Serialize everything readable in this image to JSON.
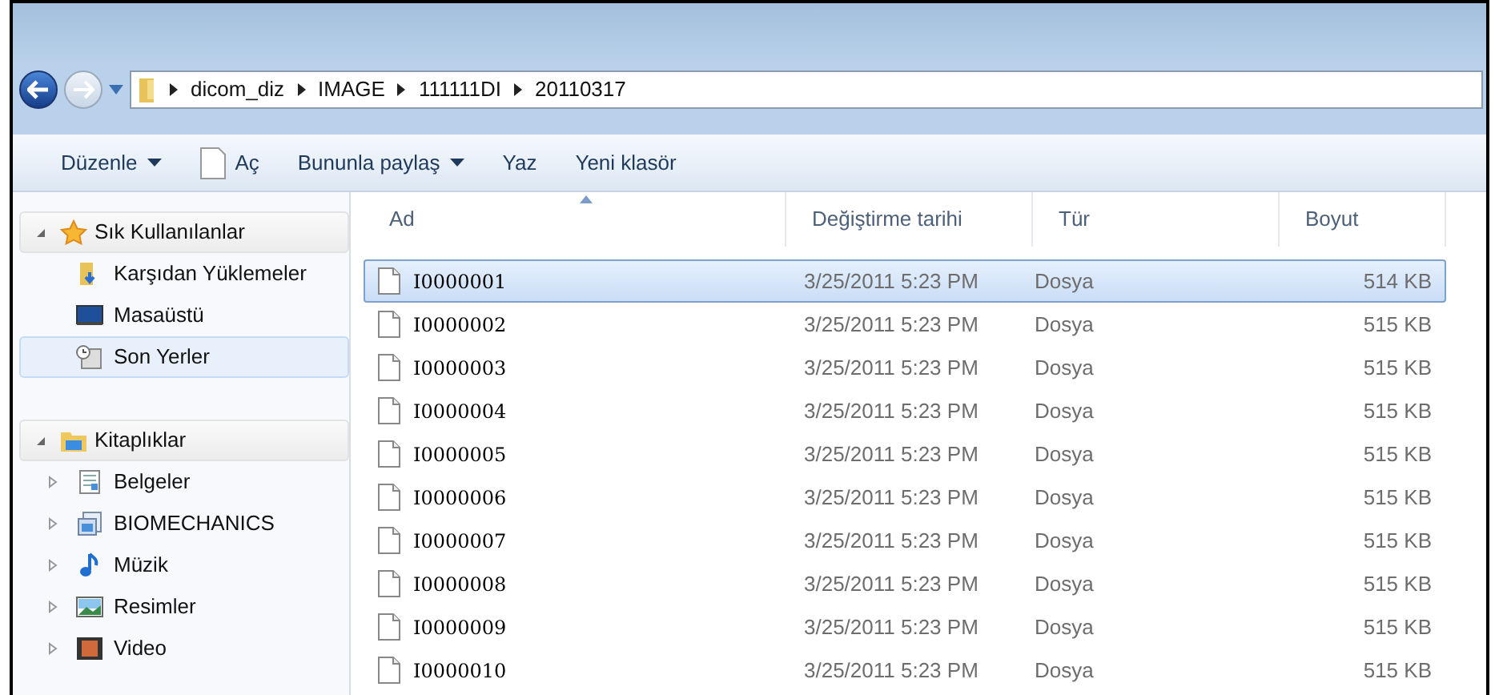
{
  "breadcrumb": [
    "dicom_diz",
    "IMAGE",
    "111111DI",
    "20110317"
  ],
  "toolbar": [
    {
      "label": "Düzenle",
      "dropdown": true,
      "icon": false
    },
    {
      "label": "Aç",
      "dropdown": false,
      "icon": true
    },
    {
      "label": "Bununla paylaş",
      "dropdown": true,
      "icon": false
    },
    {
      "label": "Yaz",
      "dropdown": false,
      "icon": false
    },
    {
      "label": "Yeni klasör",
      "dropdown": false,
      "icon": false
    }
  ],
  "sidebar": {
    "groups": [
      {
        "label": "Sık Kullanılanlar",
        "kind": "star",
        "expanded": true,
        "children": [
          {
            "label": "Karşıdan Yüklemeler",
            "kind": "downloads",
            "selected": false
          },
          {
            "label": "Masaüstü",
            "kind": "desktop",
            "selected": false
          },
          {
            "label": "Son Yerler",
            "kind": "recent",
            "selected": true
          }
        ]
      },
      {
        "label": "Kitaplıklar",
        "kind": "library",
        "expanded": true,
        "children": [
          {
            "label": "Belgeler",
            "kind": "documents",
            "selected": false,
            "expanded": false
          },
          {
            "label": "BIOMECHANICS",
            "kind": "stack",
            "selected": false,
            "expanded": false
          },
          {
            "label": "Müzik",
            "kind": "music",
            "selected": false,
            "expanded": false
          },
          {
            "label": "Resimler",
            "kind": "pictures",
            "selected": false,
            "expanded": false
          },
          {
            "label": "Video",
            "kind": "video",
            "selected": false,
            "expanded": false
          }
        ]
      }
    ]
  },
  "table": {
    "columns": [
      "Ad",
      "Değiştirme tarihi",
      "Tür",
      "Boyut"
    ],
    "rows": [
      {
        "name": "I0000001",
        "date": "3/25/2011 5:23 PM",
        "type": "Dosya",
        "size": "514 KB",
        "selected": true
      },
      {
        "name": "I0000002",
        "date": "3/25/2011 5:23 PM",
        "type": "Dosya",
        "size": "515 KB",
        "selected": false
      },
      {
        "name": "I0000003",
        "date": "3/25/2011 5:23 PM",
        "type": "Dosya",
        "size": "515 KB",
        "selected": false
      },
      {
        "name": "I0000004",
        "date": "3/25/2011 5:23 PM",
        "type": "Dosya",
        "size": "515 KB",
        "selected": false
      },
      {
        "name": "I0000005",
        "date": "3/25/2011 5:23 PM",
        "type": "Dosya",
        "size": "515 KB",
        "selected": false
      },
      {
        "name": "I0000006",
        "date": "3/25/2011 5:23 PM",
        "type": "Dosya",
        "size": "515 KB",
        "selected": false
      },
      {
        "name": "I0000007",
        "date": "3/25/2011 5:23 PM",
        "type": "Dosya",
        "size": "515 KB",
        "selected": false
      },
      {
        "name": "I0000008",
        "date": "3/25/2011 5:23 PM",
        "type": "Dosya",
        "size": "515 KB",
        "selected": false
      },
      {
        "name": "I0000009",
        "date": "3/25/2011 5:23 PM",
        "type": "Dosya",
        "size": "515 KB",
        "selected": false
      },
      {
        "name": "I0000010",
        "date": "3/25/2011 5:23 PM",
        "type": "Dosya",
        "size": "515 KB",
        "selected": false
      }
    ]
  }
}
